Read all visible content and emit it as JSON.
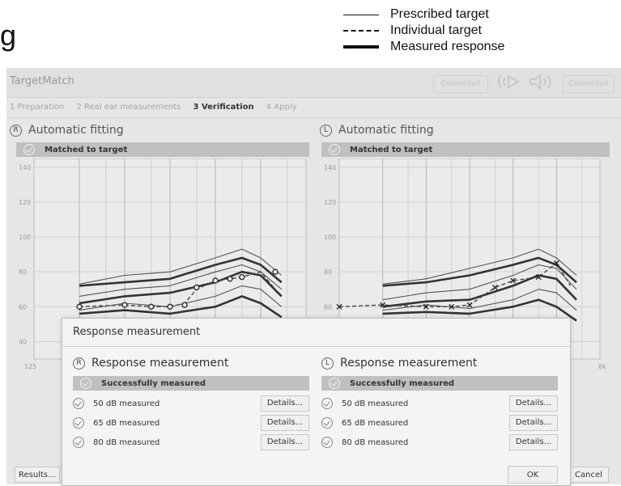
{
  "page": {
    "partial_heading": "g"
  },
  "legend": [
    {
      "style": "solid",
      "label": "Prescribed target"
    },
    {
      "style": "dashed",
      "label": "Individual target"
    },
    {
      "style": "thick",
      "label": "Measured response"
    }
  ],
  "app": {
    "title": "TargetMatch",
    "connected_left": "Connected",
    "connected_right": "Connected",
    "left_device_icon": "hearing-aid-left-icon",
    "right_device_icon": "hearing-aid-right-icon"
  },
  "steps": [
    {
      "label": "1 Preparation",
      "active": false
    },
    {
      "label": "2 Real ear measurements",
      "active": false
    },
    {
      "label": "3 Verification",
      "active": true
    },
    {
      "label": "4 Apply",
      "active": false
    }
  ],
  "right_panel": {
    "ear": "R",
    "title": "Automatic fitting",
    "status": "Matched to target"
  },
  "left_panel": {
    "ear": "L",
    "title": "Automatic fitting",
    "status": "Matched to target"
  },
  "chart_data": [
    {
      "type": "line",
      "ear": "right",
      "x_scale": "log",
      "x_ticks": [
        "125"
      ],
      "y_ticks": [
        140,
        120,
        100,
        80,
        60,
        40
      ],
      "ylim": [
        30,
        145
      ],
      "xlim": [
        125,
        8000
      ],
      "grid": true,
      "marker": "circle",
      "series": [
        {
          "style": "thin",
          "x": [
            250,
            500,
            1000,
            2000,
            3000,
            4000,
            5500
          ],
          "values": [
            73,
            78,
            80,
            88,
            93,
            88,
            78
          ]
        },
        {
          "style": "thick",
          "x": [
            250,
            500,
            1000,
            2000,
            3000,
            4000,
            5500
          ],
          "values": [
            72,
            74,
            76,
            84,
            88,
            84,
            74
          ]
        },
        {
          "style": "thin",
          "x": [
            250,
            500,
            1000,
            2000,
            3000,
            4000,
            5500
          ],
          "values": [
            66,
            70,
            72,
            80,
            84,
            80,
            70
          ]
        },
        {
          "style": "thick",
          "x": [
            250,
            500,
            1000,
            2000,
            3000,
            4000,
            5500
          ],
          "values": [
            62,
            66,
            68,
            74,
            80,
            78,
            66
          ]
        },
        {
          "style": "dashed",
          "x": [
            250,
            500,
            750,
            1000,
            1250,
            1500,
            2000,
            2500,
            3000,
            4000,
            5000
          ],
          "values": [
            60,
            61,
            60,
            60,
            62,
            70,
            75,
            76,
            77,
            80,
            70
          ]
        },
        {
          "style": "thin",
          "x": [
            250,
            500,
            1000,
            2000,
            3000,
            4000,
            5500
          ],
          "values": [
            58,
            62,
            60,
            66,
            72,
            70,
            60
          ]
        },
        {
          "style": "thick",
          "x": [
            250,
            500,
            1000,
            2000,
            3000,
            4000,
            5500
          ],
          "values": [
            56,
            58,
            56,
            60,
            66,
            62,
            54
          ]
        }
      ],
      "markers": {
        "x": [
          250,
          500,
          750,
          1000,
          1250,
          1500,
          2000,
          2500,
          3000,
          5000
        ],
        "values": [
          60,
          61,
          60,
          60,
          61,
          71,
          75,
          76,
          77,
          80
        ]
      }
    },
    {
      "type": "line",
      "ear": "left",
      "x_scale": "log",
      "x_ticks": [
        "8k"
      ],
      "y_ticks": [
        140,
        120,
        100,
        80,
        60,
        40
      ],
      "ylim": [
        30,
        145
      ],
      "xlim": [
        125,
        8000
      ],
      "grid": true,
      "marker": "x",
      "series": [
        {
          "style": "thin",
          "x": [
            250,
            500,
            1000,
            2000,
            3000,
            4000,
            5500
          ],
          "values": [
            73,
            76,
            82,
            88,
            93,
            88,
            78
          ]
        },
        {
          "style": "thick",
          "x": [
            250,
            500,
            1000,
            2000,
            3000,
            4000,
            5500
          ],
          "values": [
            72,
            74,
            78,
            84,
            88,
            84,
            74
          ]
        },
        {
          "style": "thin",
          "x": [
            250,
            500,
            1000,
            2000,
            3000,
            4000,
            5500
          ],
          "values": [
            64,
            68,
            70,
            78,
            84,
            82,
            70
          ]
        },
        {
          "style": "thick",
          "x": [
            250,
            500,
            1000,
            2000,
            3000,
            4000,
            5500
          ],
          "values": [
            60,
            63,
            64,
            72,
            78,
            76,
            64
          ]
        },
        {
          "style": "dashed",
          "x": [
            125,
            250,
            500,
            750,
            1000,
            1500,
            2000,
            3000,
            4000,
            5000
          ],
          "values": [
            60,
            61,
            60,
            60,
            61,
            71,
            75,
            77,
            85,
            72
          ]
        },
        {
          "style": "thin",
          "x": [
            250,
            500,
            1000,
            2000,
            3000,
            4000,
            5500
          ],
          "values": [
            58,
            61,
            59,
            64,
            70,
            68,
            58
          ]
        },
        {
          "style": "thick",
          "x": [
            250,
            500,
            1000,
            2000,
            3000,
            4000,
            5500
          ],
          "values": [
            56,
            57,
            56,
            60,
            64,
            60,
            52
          ]
        }
      ],
      "markers": {
        "x": [
          125,
          250,
          500,
          750,
          1000,
          1500,
          2000,
          3000,
          4000
        ],
        "values": [
          60,
          61,
          60,
          60,
          61,
          71,
          75,
          77,
          85
        ]
      }
    }
  ],
  "dialog": {
    "title": "Response measurement",
    "right": {
      "ear": "R",
      "title": "Response measurement",
      "status": "Successfully measured",
      "rows": [
        {
          "label": "50 dB measured",
          "button": "Details..."
        },
        {
          "label": "65 dB measured",
          "button": "Details..."
        },
        {
          "label": "80 dB measured",
          "button": "Details..."
        }
      ]
    },
    "left": {
      "ear": "L",
      "title": "Response measurement",
      "status": "Successfully measured",
      "rows": [
        {
          "label": "50 dB measured",
          "button": "Details..."
        },
        {
          "label": "65 dB measured",
          "button": "Details..."
        },
        {
          "label": "80 dB measured",
          "button": "Details..."
        }
      ]
    },
    "ok": "OK"
  },
  "footer": {
    "results": "Results...",
    "cancel": "Cancel"
  }
}
